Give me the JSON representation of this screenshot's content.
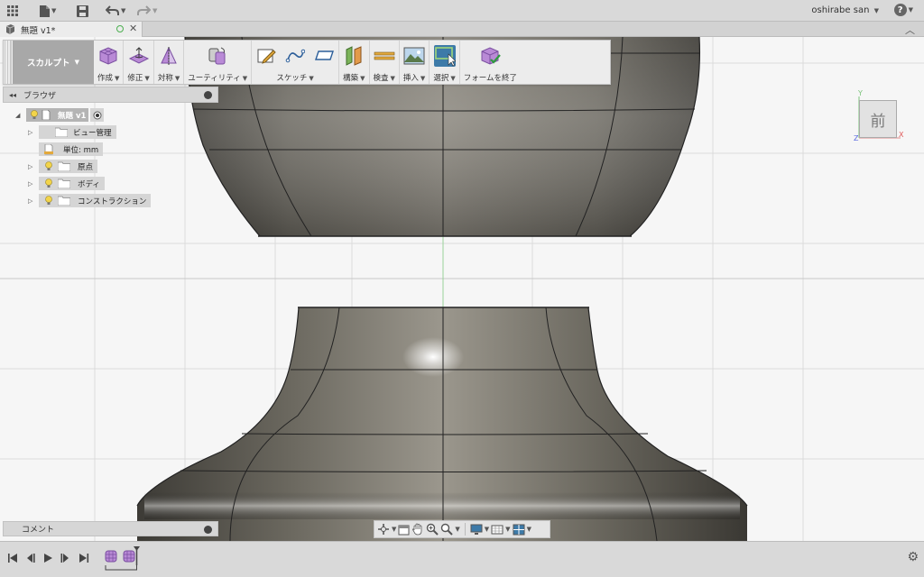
{
  "appbar": {
    "icons": [
      "grid-icon",
      "file-icon",
      "save-icon",
      "undo-icon",
      "redo-icon"
    ],
    "user": "oshirabe san",
    "help": "?"
  },
  "tab": {
    "title": "無題 v1*"
  },
  "toolbar": {
    "workspace": "スカルプト",
    "groups": [
      {
        "label": "作成"
      },
      {
        "label": "修正"
      },
      {
        "label": "対称"
      },
      {
        "label": "ユーティリティ"
      },
      {
        "label": "スケッチ"
      },
      {
        "label": "構築"
      },
      {
        "label": "検査"
      },
      {
        "label": "挿入"
      },
      {
        "label": "選択"
      },
      {
        "label": "フォームを終了"
      }
    ]
  },
  "browser": {
    "title": "ブラウザ",
    "items": [
      {
        "label": "無題 v1"
      },
      {
        "label": "ビュー管理"
      },
      {
        "label": "単位: mm"
      },
      {
        "label": "原点"
      },
      {
        "label": "ボディ"
      },
      {
        "label": "コンストラクション"
      }
    ]
  },
  "comment": {
    "title": "コメント"
  },
  "viewcube": {
    "face": "前",
    "axis_y": "Y",
    "axis_x": "X",
    "axis_z": "Z"
  },
  "colors": {
    "accent": "#3d7aa8",
    "workspace_bg": "#a8a8a8",
    "body_dark": "#5e5b55"
  }
}
